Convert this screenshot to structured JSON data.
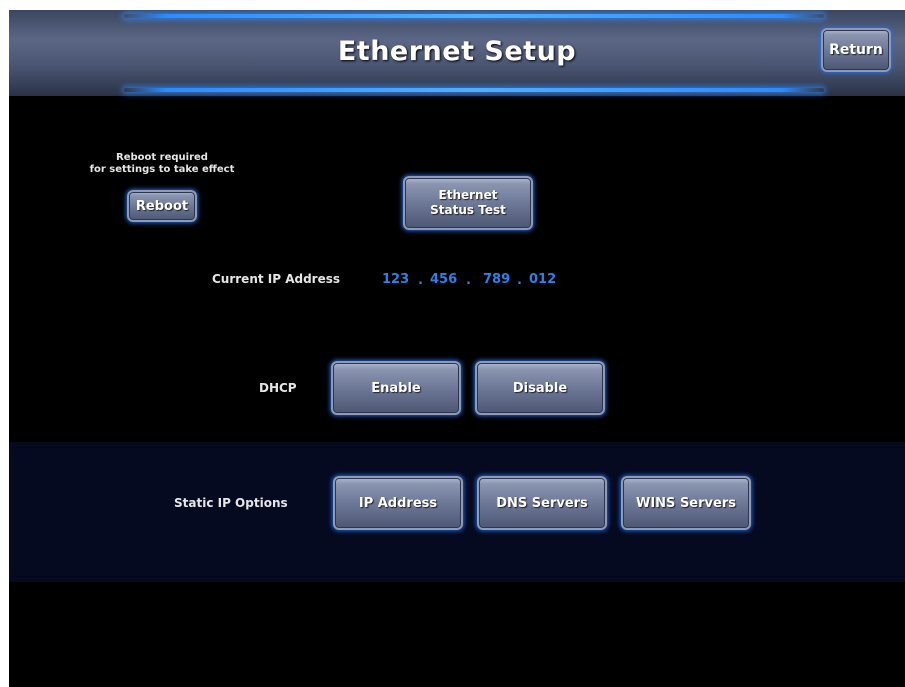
{
  "header": {
    "title": "Ethernet Setup",
    "return_label": "Return"
  },
  "reboot": {
    "note": "Reboot required\nfor settings to take effect",
    "note_line1": "Reboot required",
    "note_line2": "for settings to take effect",
    "button_label": "Reboot"
  },
  "status_test": {
    "line1": "Ethernet",
    "line2": "Status Test"
  },
  "current_ip": {
    "label": "Current IP Address",
    "octets": [
      "123",
      "456",
      "789",
      "012"
    ],
    "separator": "."
  },
  "dhcp": {
    "label": "DHCP",
    "enable_label": "Enable",
    "disable_label": "Disable"
  },
  "static_ip": {
    "label": "Static IP Options",
    "ip_address_label": "IP Address",
    "dns_label": "DNS Servers",
    "wins_label": "WINS Servers"
  },
  "colors": {
    "background": "#000000",
    "header": "#5b6785",
    "accent_glow": "#2a8cff",
    "ip_text": "#2f7fe6",
    "static_band": "#050a20"
  }
}
